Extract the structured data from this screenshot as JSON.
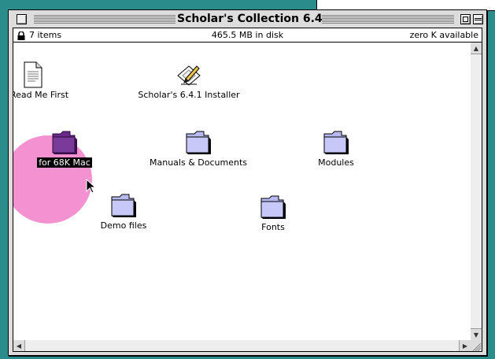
{
  "window": {
    "title": "Scholar's Collection 6.4",
    "item_count": "7 items",
    "disk_usage": "465.5 MB in disk",
    "available": "zero K available"
  },
  "icons": [
    {
      "label": "Read Me First",
      "kind": "document-icon",
      "selected": false
    },
    {
      "label": "Scholar's 6.4.1 Installer",
      "kind": "installer-icon",
      "selected": false
    },
    {
      "label": "for 68K Mac",
      "kind": "folder-icon",
      "selected": true
    },
    {
      "label": "Manuals & Documents",
      "kind": "folder-icon",
      "selected": false
    },
    {
      "label": "Modules",
      "kind": "folder-icon",
      "selected": false
    },
    {
      "label": "Demo files",
      "kind": "folder-icon",
      "selected": false
    },
    {
      "label": "Fonts",
      "kind": "folder-icon",
      "selected": false
    }
  ],
  "colors": {
    "desktop": "#2b8c8c",
    "folder": "#b8b8f0",
    "selected_folder": "#6a2a8a",
    "highlight": "#f06cc0"
  }
}
